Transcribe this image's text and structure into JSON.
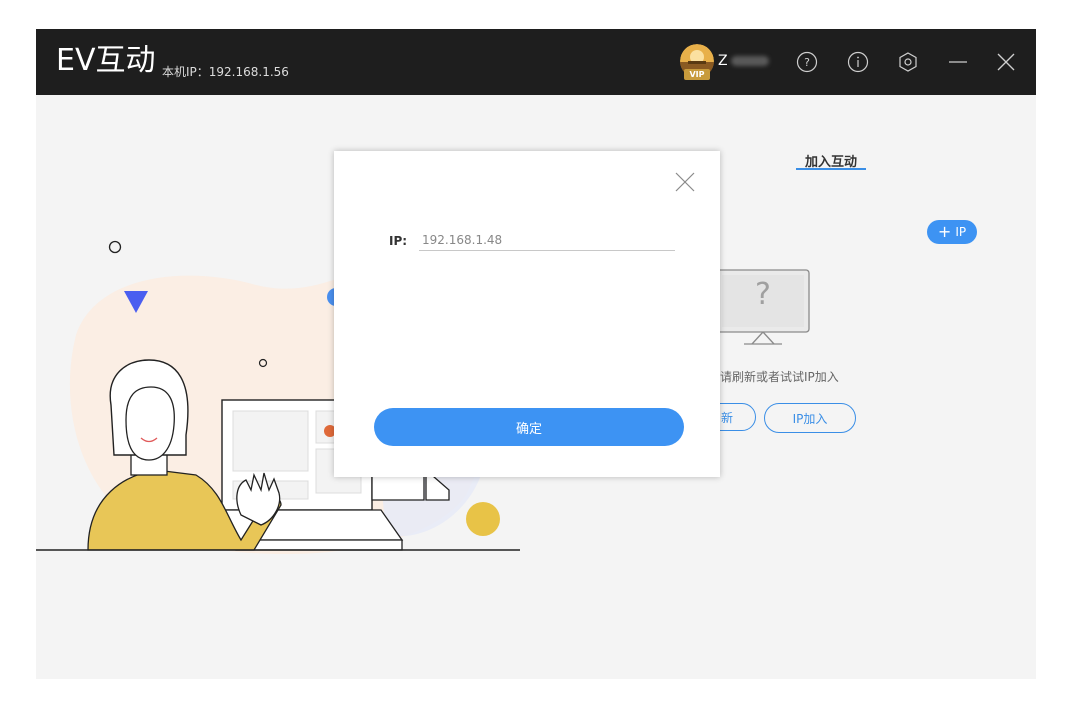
{
  "app": {
    "title": "EV互动",
    "local_ip": "本机IP：192.168.1.56"
  },
  "user": {
    "name_initial": "Z",
    "badge": "VIP"
  },
  "titlebar_icons": [
    "help-icon",
    "info-icon",
    "settings-icon",
    "minimize-icon",
    "close-icon"
  ],
  "main": {
    "tab_join": "加入互动",
    "add_ip_label": "IP",
    "empty_question": "?",
    "empty_hint": "备，请刷新或者试试IP加入",
    "refresh_label": "新",
    "ip_join_label": "IP加入"
  },
  "dialog": {
    "ip_label": "IP:",
    "ip_value": "192.168.1.48",
    "confirm_label": "确定"
  },
  "colors": {
    "titlebar": "#1e1e1e",
    "accent": "#3d93f3",
    "background": "#f4f4f4"
  }
}
